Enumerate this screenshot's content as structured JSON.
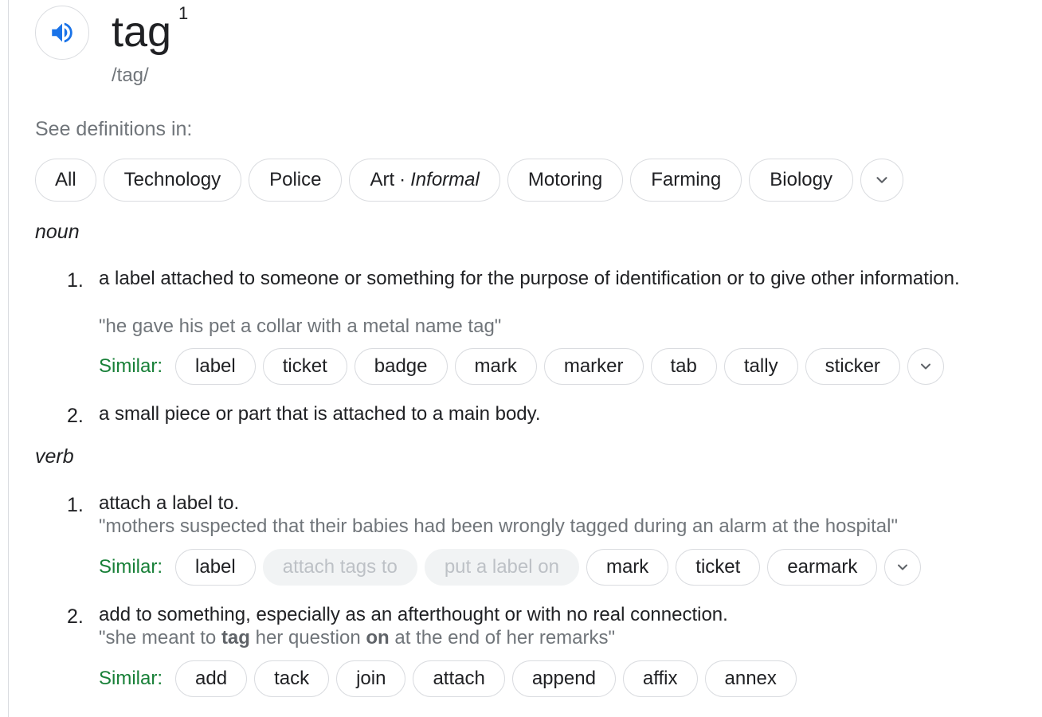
{
  "entry": {
    "headword": "tag",
    "superscript": "1",
    "phonetic": "/tag/",
    "speaker_icon": "volume-up-icon"
  },
  "see_definitions": {
    "label": "See definitions in:",
    "chips": [
      "All",
      "Technology",
      "Police",
      "Art",
      "Motoring",
      "Farming",
      "Biology"
    ],
    "art_qualifier": "Informal",
    "dot": "·",
    "more_icon": "chevron-down-icon"
  },
  "noun": {
    "pos": "noun",
    "senses": [
      {
        "num": "1.",
        "definition": "a label attached to someone or something for the purpose of identification or to give other information.",
        "example": "\"he gave his pet a collar with a metal name tag\"",
        "similar_label": "Similar:",
        "similar": [
          "label",
          "ticket",
          "badge",
          "mark",
          "marker",
          "tab",
          "tally",
          "sticker"
        ]
      },
      {
        "num": "2.",
        "definition": "a small piece or part that is attached to a main body."
      }
    ]
  },
  "verb": {
    "pos": "verb",
    "senses": [
      {
        "num": "1.",
        "definition": "attach a label to.",
        "example": "\"mothers suspected that their babies had been wrongly tagged during an alarm at the hospital\"",
        "similar_label": "Similar:",
        "similar": [
          "label",
          "attach tags to",
          "put a label on",
          "mark",
          "ticket",
          "earmark"
        ],
        "disabled": [
          "attach tags to",
          "put a label on"
        ]
      },
      {
        "num": "2.",
        "definition": "add to something, especially as an afterthought or with no real connection.",
        "example_parts": [
          "\"she meant to ",
          "tag",
          " her question ",
          "on",
          " at the end of her remarks\""
        ],
        "similar_label": "Similar:",
        "similar": [
          "add",
          "tack",
          "join",
          "attach",
          "append",
          "affix",
          "annex"
        ]
      }
    ]
  },
  "colors": {
    "accent_blue": "#1a73e8",
    "similar_green": "#188038",
    "muted_text": "#70757a",
    "chip_border": "#dadce0"
  }
}
